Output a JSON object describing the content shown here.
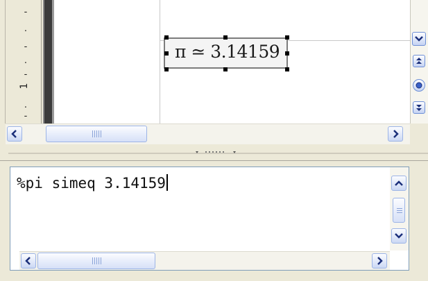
{
  "ruler": {
    "marks": [
      "-",
      ".",
      "-",
      ".",
      "-",
      ".",
      "1",
      "-"
    ]
  },
  "formula_display": {
    "text": "π ≃ 3.14159"
  },
  "command_editor": {
    "text": "%pi simeq 3.14159"
  },
  "scroll_glyphs": {
    "left": "<",
    "right": ">",
    "up": "^",
    "down": "v"
  },
  "colors": {
    "accent": "#9cb4e6",
    "background": "#ece9d8"
  }
}
